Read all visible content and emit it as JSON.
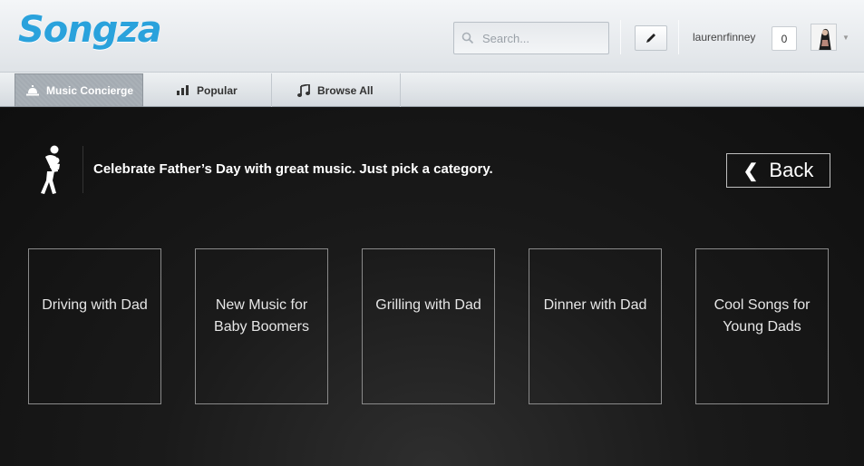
{
  "header": {
    "logo": "Songza",
    "search": {
      "placeholder": "Search..."
    },
    "edit_icon": "pencil-icon",
    "username": "laurenrfinney",
    "count": "0",
    "avatar_icon": "user-avatar"
  },
  "nav": {
    "tabs": [
      {
        "label": "Music Concierge",
        "icon": "bell-icon",
        "active": true
      },
      {
        "label": "Popular",
        "icon": "bar-chart-icon",
        "active": false
      },
      {
        "label": "Browse All",
        "icon": "music-note-icon",
        "active": false
      }
    ]
  },
  "main": {
    "intro_icon": "dad-carrying-child-icon",
    "intro_text": "Celebrate Father’s Day with great music. Just pick a category.",
    "back_label": "Back",
    "categories": [
      {
        "label": "Driving with Dad"
      },
      {
        "label": "New Music for Baby Boomers"
      },
      {
        "label": "Grilling with Dad"
      },
      {
        "label": "Dinner with Dad"
      },
      {
        "label": "Cool Songs for Young Dads"
      }
    ]
  },
  "colors": {
    "brand": "#2aa2dc",
    "background": "#151515",
    "active_tab": "#a4abb2"
  }
}
